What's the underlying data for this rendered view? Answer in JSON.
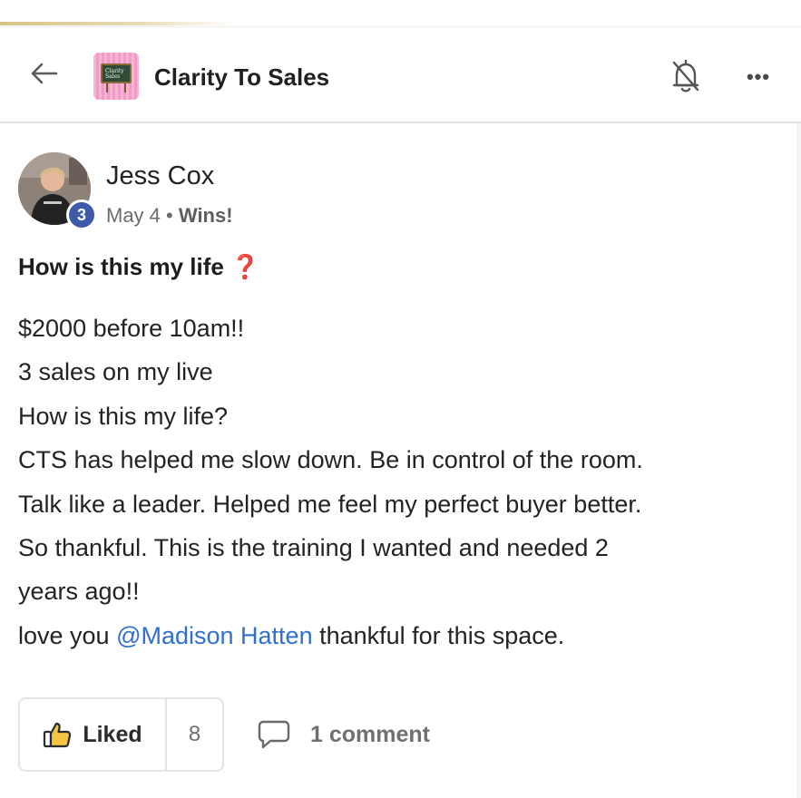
{
  "header": {
    "group_name": "Clarity To Sales",
    "logo_text": "Clarity Sales",
    "icons": {
      "back": "arrow-left-icon",
      "notify": "bell-off-icon",
      "more": "more-horizontal-icon"
    }
  },
  "post": {
    "author": "Jess Cox",
    "level": "3",
    "date": "May 4",
    "separator": "•",
    "category": "Wins!",
    "title": "How is this my life",
    "title_emoji": "❓",
    "body": {
      "line1": "$2000 before 10am!!",
      "line2": "3 sales on my live",
      "line3": "How is this my life?",
      "line4": "CTS has helped me slow down. Be in control of the room.",
      "line5": "Talk like a leader. Helped me feel my perfect buyer better.",
      "line6": "So thankful. This is the training I wanted and needed 2",
      "line7": "years ago!!",
      "line8_pre": "love you ",
      "line8_mention": "@Madison Hatten",
      "line8_post": " thankful for this space."
    }
  },
  "actions": {
    "like_label": "Liked",
    "like_count": "8",
    "comment_label": "1 comment"
  },
  "colors": {
    "mention": "#2f6fd0",
    "level_badge": "#3f5aa8",
    "emoji_red": "#d12b2b",
    "accent_gold": "#d8c285"
  }
}
